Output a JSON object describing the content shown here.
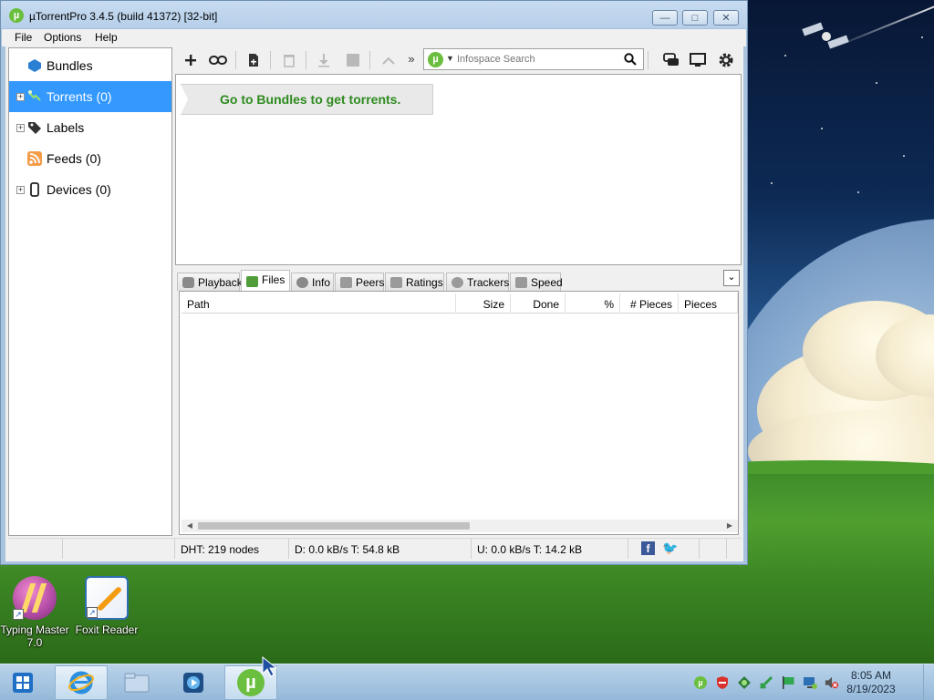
{
  "window": {
    "title": "µTorrentPro 3.4.5  (build 41372) [32-bit]",
    "controls": {
      "minimize": "—",
      "maximize": "□",
      "close": "✕"
    }
  },
  "menu": {
    "file": "File",
    "options": "Options",
    "help": "Help"
  },
  "sidebar": {
    "items": [
      {
        "label": "Bundles",
        "icon": "bundles-icon"
      },
      {
        "label": "Torrents (0)",
        "icon": "torrents-icon",
        "selected": true
      },
      {
        "label": "Labels",
        "icon": "label-tag-icon"
      },
      {
        "label": "Feeds (0)",
        "icon": "rss-feed-icon"
      },
      {
        "label": "Devices (0)",
        "icon": "device-phone-icon"
      }
    ]
  },
  "toolbar": {
    "search_placeholder": "Infospace Search",
    "overflow": "»"
  },
  "list": {
    "banner": "Go to Bundles to get torrents."
  },
  "tabs": [
    {
      "label": "Playback",
      "icon": "playback-icon"
    },
    {
      "label": "Files",
      "icon": "files-icon",
      "active": true
    },
    {
      "label": "Info",
      "icon": "info-icon"
    },
    {
      "label": "Peers",
      "icon": "peers-icon"
    },
    {
      "label": "Ratings",
      "icon": "ratings-icon"
    },
    {
      "label": "Trackers",
      "icon": "trackers-icon"
    },
    {
      "label": "Speed",
      "icon": "speed-icon"
    }
  ],
  "files": {
    "columns": [
      "Path",
      "Size",
      "Done",
      "%",
      "# Pieces",
      "Pieces"
    ],
    "rows": []
  },
  "status": {
    "dht": "DHT: 219 nodes",
    "download": "D: 0.0 kB/s T: 54.8 kB",
    "upload": "U: 0.0 kB/s T: 14.2 kB"
  },
  "desktop": {
    "icons": [
      {
        "label": "Typing Master 7.0"
      },
      {
        "label": "Foxit Reader"
      }
    ]
  },
  "taskbar": {
    "time": "8:05 AM",
    "date": "8/19/2023"
  },
  "colors": {
    "selection": "#3399ff",
    "banner_text": "#2e8b1f",
    "utorrent_green": "#6bbf3f"
  }
}
